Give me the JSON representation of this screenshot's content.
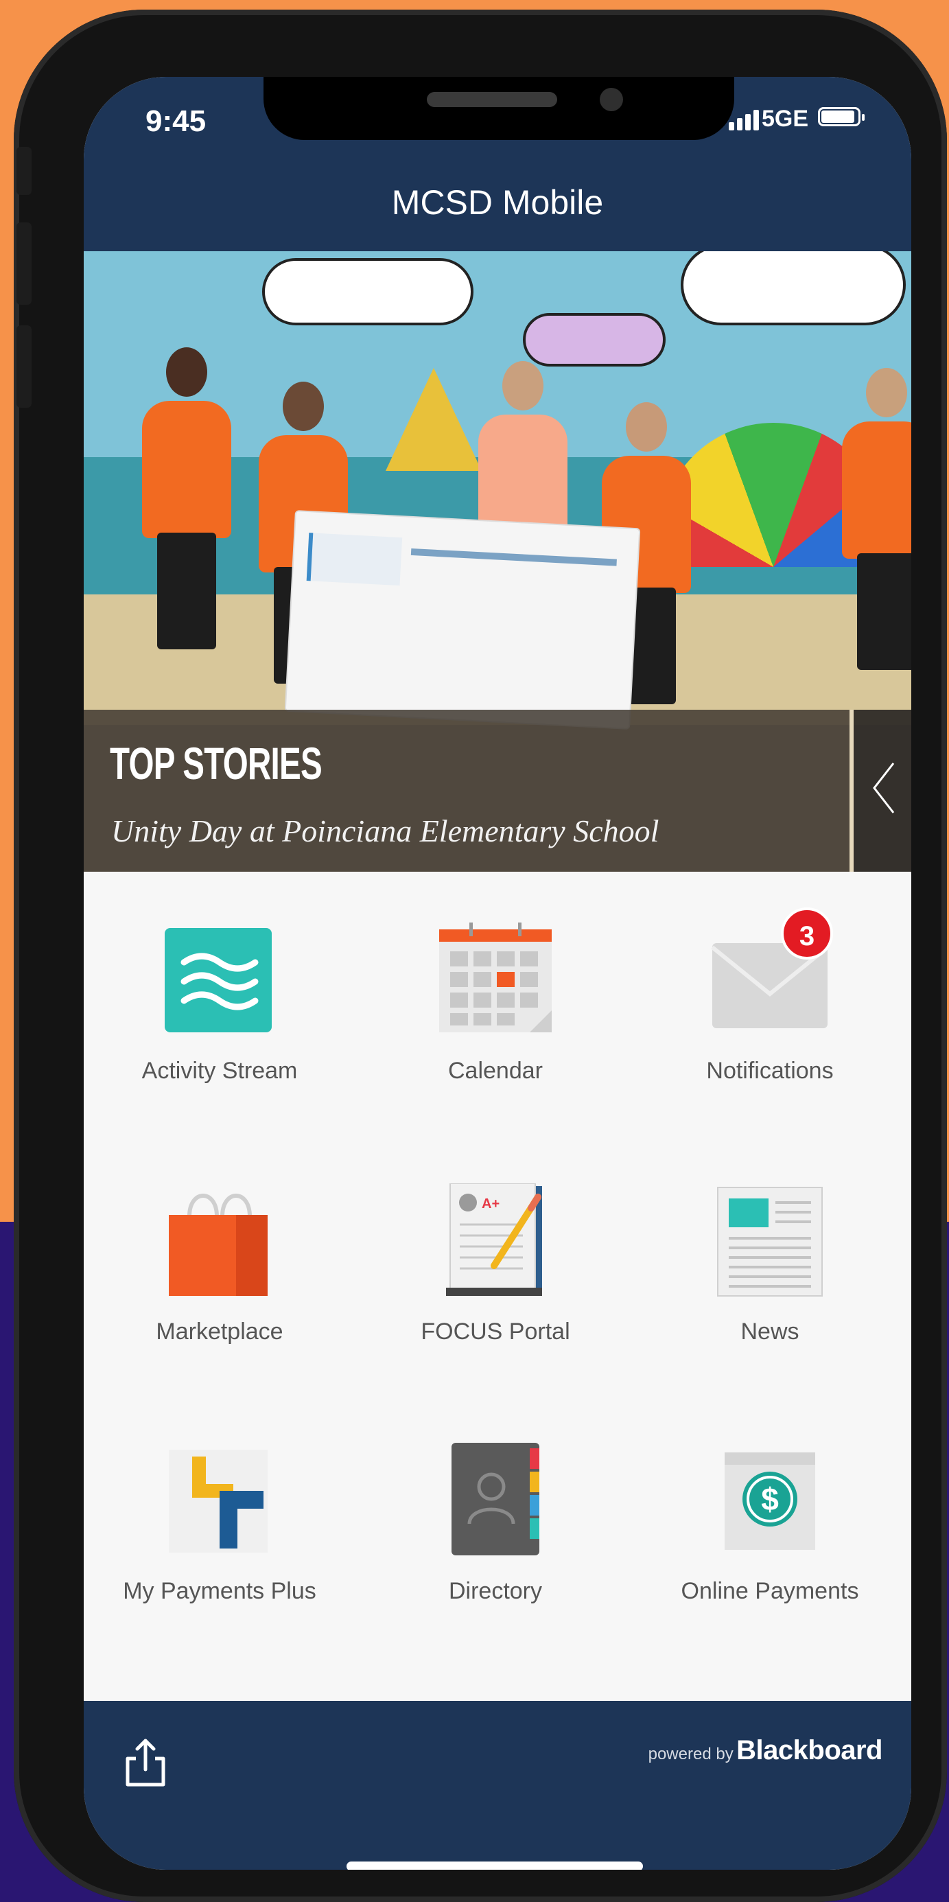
{
  "status_bar": {
    "time": "9:45",
    "network": "5GE"
  },
  "header": {
    "title": "MCSD Mobile"
  },
  "hero": {
    "section_label": "TOP STORIES",
    "story_title": "Unity Day at Poinciana Elementary School"
  },
  "apps": [
    {
      "label": "Activity Stream",
      "icon": "activity-stream-icon"
    },
    {
      "label": "Calendar",
      "icon": "calendar-icon"
    },
    {
      "label": "Notifications",
      "icon": "envelope-icon",
      "badge": "3"
    },
    {
      "label": "Marketplace",
      "icon": "shopping-bag-icon"
    },
    {
      "label": "FOCUS Portal",
      "icon": "gradebook-icon"
    },
    {
      "label": "News",
      "icon": "newspaper-icon"
    },
    {
      "label": "My Payments Plus",
      "icon": "my-payments-plus-icon"
    },
    {
      "label": "Directory",
      "icon": "address-book-icon"
    },
    {
      "label": "Online Payments",
      "icon": "dollar-icon"
    }
  ],
  "pager": {
    "pages": 2,
    "current": 1
  },
  "footer": {
    "powered_by": "powered by",
    "brand": "Blackboard"
  },
  "colors": {
    "navy": "#1d3557",
    "badge_red": "#e31b23",
    "background_orange": "#f6924a",
    "background_purple": "#2a1672"
  }
}
